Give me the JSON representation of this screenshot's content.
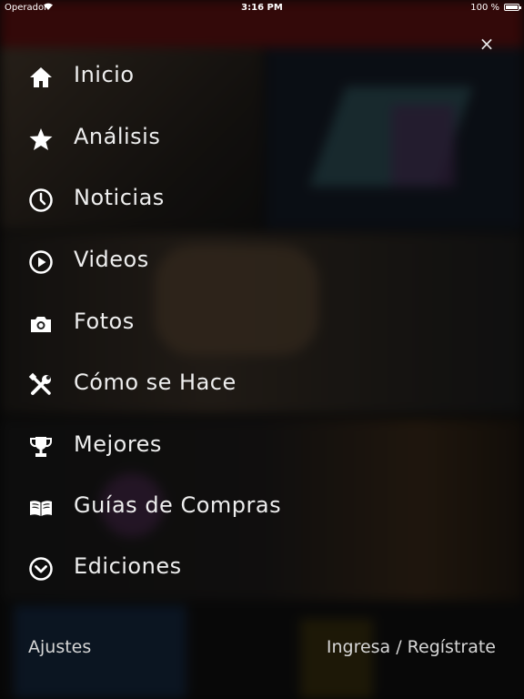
{
  "status_bar": {
    "carrier": "Operador",
    "time": "3:16 PM",
    "battery": "100 %"
  },
  "menu": {
    "items": [
      {
        "label": "Inicio",
        "icon": "home-icon"
      },
      {
        "label": "Análisis",
        "icon": "star-icon"
      },
      {
        "label": "Noticias",
        "icon": "clock-icon"
      },
      {
        "label": "Videos",
        "icon": "play-icon"
      },
      {
        "label": "Fotos",
        "icon": "camera-icon"
      },
      {
        "label": "Cómo se Hace",
        "icon": "tools-icon"
      },
      {
        "label": "Mejores",
        "icon": "trophy-icon"
      },
      {
        "label": "Guías de Compras",
        "icon": "book-icon"
      },
      {
        "label": "Ediciones",
        "icon": "chevron-circle-icon"
      }
    ]
  },
  "close_label": "×",
  "footer": {
    "settings": "Ajustes",
    "login": "Ingresa / Regístrate"
  }
}
